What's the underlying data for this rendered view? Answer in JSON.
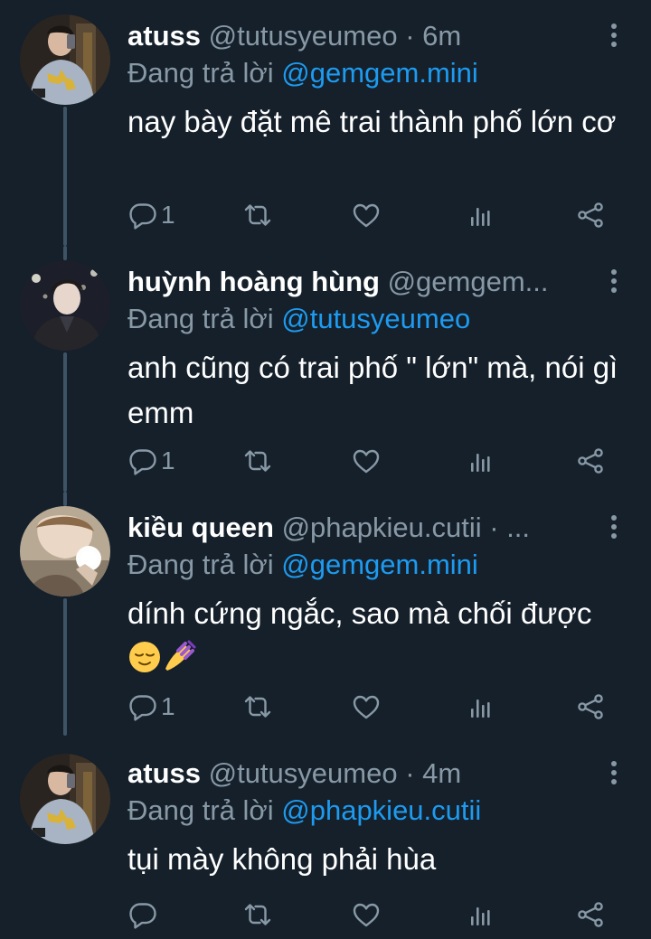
{
  "tweets": [
    {
      "name": "atuss",
      "handle": "@tutusyeumeo",
      "dot": "·",
      "time": "6m",
      "reply_prefix": "Đang trả lời",
      "reply_to": "@gemgem.mini",
      "text": "nay bày đặt mê trai thành phố lớn cơ",
      "reply_count": "1"
    },
    {
      "name": "huỳnh hoàng hùng",
      "handle": "@gemgem...",
      "dot": "",
      "time": "",
      "reply_prefix": "Đang trả lời",
      "reply_to": "@tutusyeumeo",
      "text": "anh cũng có trai phố \" lớn\" mà, nói gì emm",
      "reply_count": "1"
    },
    {
      "name": "kiều queen",
      "handle": "@phapkieu.cutii",
      "dot": "·",
      "time": "...",
      "reply_prefix": "Đang trả lời",
      "reply_to": "@gemgem.mini",
      "text": "dính cứng ngắc, sao mà chối được",
      "reply_count": "1"
    },
    {
      "name": "atuss",
      "handle": "@tutusyeumeo",
      "dot": "·",
      "time": "4m",
      "reply_prefix": "Đang trả lời",
      "reply_to": "@phapkieu.cutii",
      "text": "tụi mày không phải hùa",
      "reply_count": ""
    }
  ],
  "icons": {
    "reply": "reply-icon",
    "retweet": "retweet-icon",
    "like": "heart-icon",
    "analytics": "analytics-icon",
    "share": "share-icon",
    "more": "more-vertical-icon",
    "emoji": [
      "relieved-face-emoji",
      "nail-polish-emoji"
    ]
  },
  "colors": {
    "background": "#15202b",
    "secondary_text": "#8899a6",
    "link": "#1d9bf0",
    "thread_line": "#3d5466"
  }
}
